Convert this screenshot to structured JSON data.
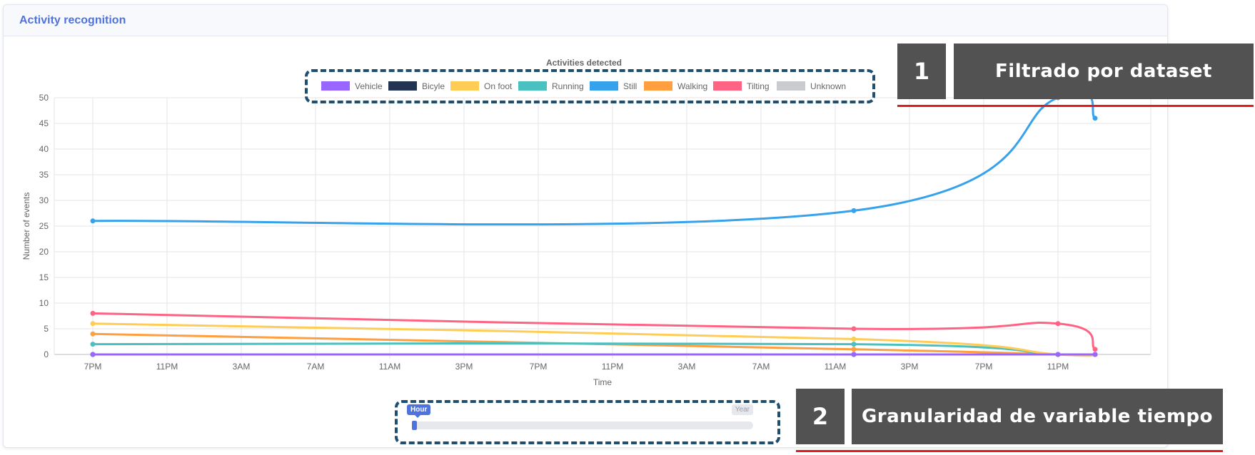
{
  "card": {
    "title": "Activity recognition"
  },
  "chart_data": {
    "type": "line",
    "title": "Activities detected",
    "xlabel": "Time",
    "ylabel": "Number of events",
    "ylim": [
      0,
      50
    ],
    "yticks": [
      0,
      5,
      10,
      15,
      20,
      25,
      30,
      35,
      40,
      45,
      50
    ],
    "xticks": [
      "7PM",
      "11PM",
      "3AM",
      "7AM",
      "11AM",
      "3PM",
      "7PM",
      "11PM",
      "3AM",
      "7AM",
      "11AM",
      "3PM",
      "7PM",
      "11PM"
    ],
    "x_hours": [
      0,
      41,
      52,
      54
    ],
    "legend_position": "top-center",
    "grid": true,
    "series": [
      {
        "name": "Vehicle",
        "color": "#9966ff",
        "values": [
          0,
          0,
          0,
          0
        ]
      },
      {
        "name": "Bicyle",
        "color": "#233352",
        "values": [
          0,
          0,
          0,
          0
        ]
      },
      {
        "name": "On foot",
        "color": "#ffcd56",
        "values": [
          6,
          3,
          0,
          0
        ]
      },
      {
        "name": "Running",
        "color": "#4bc0c0",
        "values": [
          2,
          2,
          0,
          0
        ]
      },
      {
        "name": "Still",
        "color": "#36a2eb",
        "values": [
          26,
          28,
          50,
          46
        ]
      },
      {
        "name": "Walking",
        "color": "#ff9f40",
        "values": [
          4,
          1,
          0,
          0
        ]
      },
      {
        "name": "Tilting",
        "color": "#ff6384",
        "values": [
          8,
          5,
          6,
          1
        ]
      },
      {
        "name": "Unknown",
        "color": "#c9cbcf",
        "values": [
          0,
          0,
          0,
          0
        ]
      }
    ]
  },
  "slider": {
    "value_label": "Hour",
    "max_label": "Year",
    "position": 0
  },
  "annotations": [
    {
      "number": "1",
      "label": "Filtrado por dataset"
    },
    {
      "number": "2",
      "label": "Granularidad de variable tiempo"
    }
  ]
}
